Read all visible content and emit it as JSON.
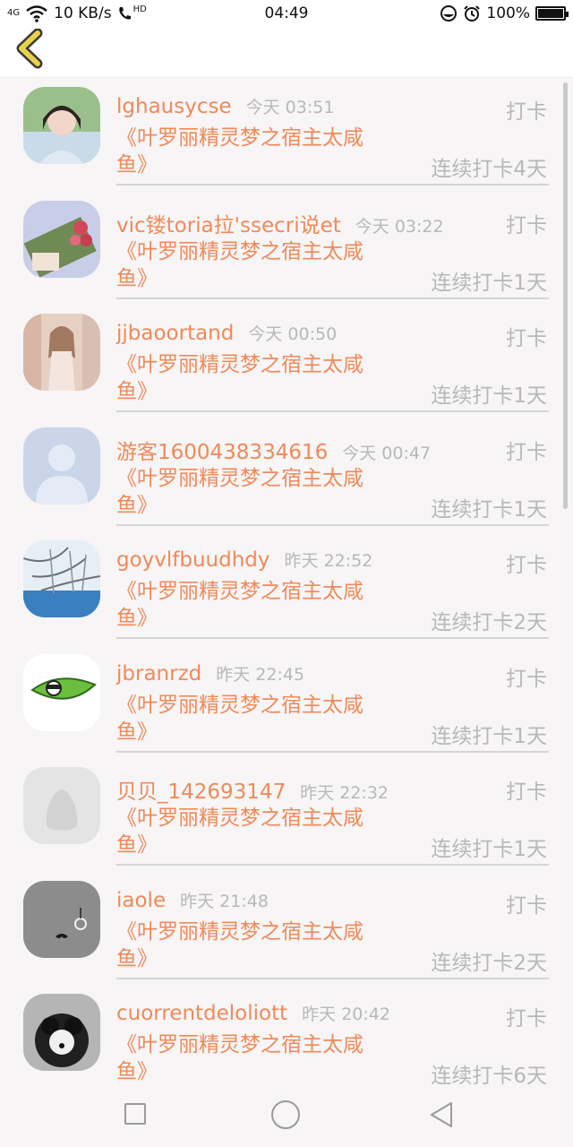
{
  "status_bar": {
    "signal": "4G",
    "speed": "10 KB/s",
    "call": "HD",
    "time": "04:49",
    "battery": "100%"
  },
  "header": {
    "back_icon": "chevron-left-icon"
  },
  "entries": [
    {
      "name": "lghausycse",
      "time": "今天 03:51",
      "action": "打卡",
      "book": "《叶罗丽精灵梦之宿主太咸鱼》",
      "streak": "连续打卡4天"
    },
    {
      "name": "vic镂toria拉'ssecri说et",
      "time": "今天 03:22",
      "action": "打卡",
      "book": "《叶罗丽精灵梦之宿主太咸鱼》",
      "streak": "连续打卡1天"
    },
    {
      "name": "jjbaoortand",
      "time": "今天 00:50",
      "action": "打卡",
      "book": "《叶罗丽精灵梦之宿主太咸鱼》",
      "streak": "连续打卡1天"
    },
    {
      "name": "游客1600438334616",
      "time": "今天 00:47",
      "action": "打卡",
      "book": "《叶罗丽精灵梦之宿主太咸鱼》",
      "streak": "连续打卡1天"
    },
    {
      "name": "goyvlfbuudhdy",
      "time": "昨天 22:52",
      "action": "打卡",
      "book": "《叶罗丽精灵梦之宿主太咸鱼》",
      "streak": "连续打卡2天"
    },
    {
      "name": "jbranrzd",
      "time": "昨天 22:45",
      "action": "打卡",
      "book": "《叶罗丽精灵梦之宿主太咸鱼》",
      "streak": "连续打卡1天"
    },
    {
      "name": "贝贝_142693147",
      "time": "昨天 22:32",
      "action": "打卡",
      "book": "《叶罗丽精灵梦之宿主太咸鱼》",
      "streak": "连续打卡1天"
    },
    {
      "name": "iaole",
      "time": "昨天 21:48",
      "action": "打卡",
      "book": "《叶罗丽精灵梦之宿主太咸鱼》",
      "streak": "连续打卡2天"
    },
    {
      "name": "cuorrentdeloliott",
      "time": "昨天 20:42",
      "action": "打卡",
      "book": "《叶罗丽精灵梦之宿主太咸鱼》",
      "streak": "连续打卡6天"
    }
  ],
  "colors": {
    "accent": "#ef8a59",
    "muted": "#b8b8b8",
    "back_icon": "#e9d24a"
  },
  "nav": {
    "recent_icon": "square-icon",
    "home_icon": "circle-icon",
    "back_icon": "triangle-back-icon"
  }
}
